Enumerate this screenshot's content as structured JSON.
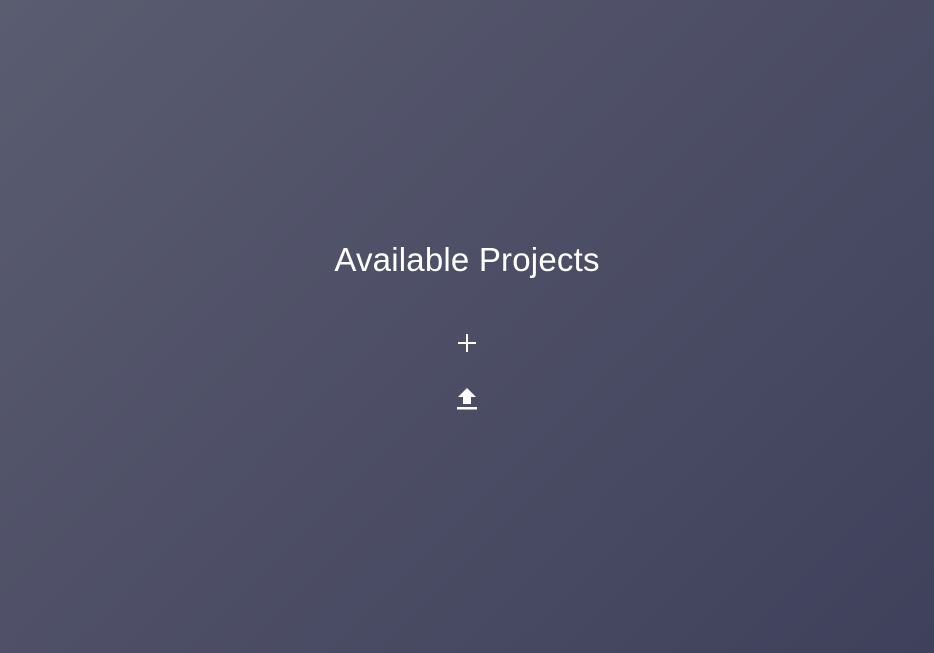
{
  "page": {
    "title": "Available Projects"
  },
  "actions": {
    "add_icon": "plus-icon",
    "upload_icon": "upload-icon"
  },
  "colors": {
    "background_start": "#5a5c70",
    "background_end": "#3f405b",
    "text": "#ffffff"
  }
}
